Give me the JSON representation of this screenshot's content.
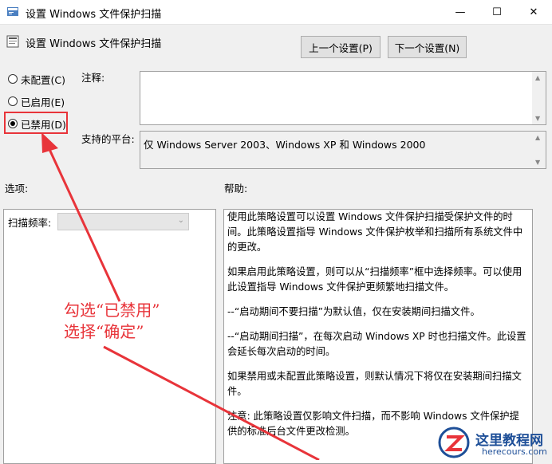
{
  "window": {
    "title": "设置 Windows 文件保护扫描",
    "minimize_glyph": "—",
    "maximize_glyph": "☐",
    "close_glyph": "✕"
  },
  "header": {
    "policy_title": "设置 Windows 文件保护扫描",
    "prev_button": "上一个设置(P)",
    "next_button": "下一个设置(N)"
  },
  "state": {
    "options": [
      {
        "label": "未配置(C)",
        "selected": false
      },
      {
        "label": "已启用(E)",
        "selected": false
      },
      {
        "label": "已禁用(D)",
        "selected": true
      }
    ]
  },
  "labels": {
    "comment": "注释:",
    "platform": "支持的平台:",
    "options": "选项:",
    "help": "帮助:",
    "scan_frequency": "扫描频率:"
  },
  "platform_text": "仅 Windows Server 2003、Windows XP 和 Windows 2000",
  "help_paragraphs": [
    "使用此策略设置可以设置 Windows 文件保护扫描受保护文件的时间。此策略设置指导 Windows 文件保护枚举和扫描所有系统文件中的更改。",
    "如果启用此策略设置，则可以从“扫描频率”框中选择频率。可以使用此设置指导 Windows 文件保护更频繁地扫描文件。",
    "--“启动期间不要扫描”为默认值，仅在安装期间扫描文件。",
    "--“启动期间扫描”，在每次启动 Windows XP 时也扫描文件。此设置会延长每次启动的时间。",
    "如果禁用或未配置此策略设置，则默认情况下将仅在安装期间扫描文件。",
    "注意: 此策略设置仅影响文件扫描，而不影响 Windows 文件保护提供的标准后台文件更改检测。"
  ],
  "annotation": {
    "line1": "勾选“已禁用”",
    "line2": "选择“确定”",
    "color": "#e8343a"
  },
  "watermark": {
    "cn": "这里教程网",
    "en": "herecours.com",
    "color": "#1e4f98"
  }
}
